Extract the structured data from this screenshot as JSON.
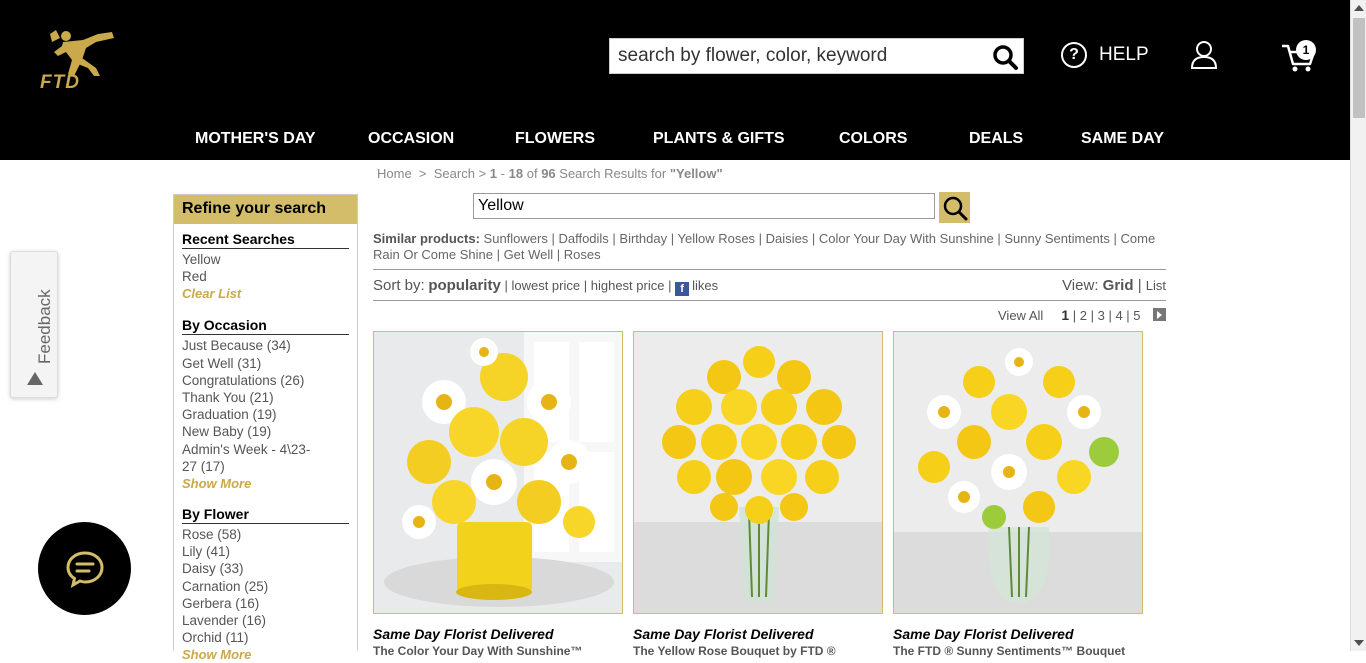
{
  "header": {
    "logo_text": "FTD",
    "search_placeholder": "search by flower, color, keyword",
    "help_label": "HELP",
    "cart_count": "1"
  },
  "nav": [
    "MOTHER'S DAY",
    "OCCASION",
    "FLOWERS",
    "PLANTS & GIFTS",
    "COLORS",
    "DEALS",
    "SAME DAY"
  ],
  "feedback_label": "Feedback",
  "breadcrumb": {
    "home": "Home",
    "sep": ">",
    "search": "Search",
    "range_start": "1",
    "dash": "-",
    "range_end": "18",
    "of": "of",
    "total": "96",
    "results_text": "Search Results for",
    "query_quoted": "\"Yellow\""
  },
  "sidebar": {
    "heading": "Refine your search",
    "recent": {
      "title": "Recent Searches",
      "items": [
        "Yellow",
        "Red"
      ],
      "clear": "Clear List"
    },
    "occasion": {
      "title": "By Occasion",
      "items": [
        "Just Because (34)",
        "Get Well (31)",
        "Congratulations (26)",
        "Thank You (21)",
        "Graduation (19)",
        "New Baby (19)",
        "Admin's Week - 4\\23-",
        "27 (17)"
      ],
      "more": "Show More"
    },
    "flower": {
      "title": "By Flower",
      "items": [
        "Rose (58)",
        "Lily (41)",
        "Daisy (33)",
        "Carnation (25)",
        "Gerbera (16)",
        "Lavender (16)",
        "Orchid (11)"
      ],
      "more": "Show More"
    }
  },
  "search2": {
    "value": "Yellow"
  },
  "similar": {
    "label": "Similar products:",
    "items": [
      "Sunflowers",
      "Daffodils",
      "Birthday",
      "Yellow Roses",
      "Daisies",
      "Color Your Day With Sunshine",
      "Sunny Sentiments",
      "Come Rain Or Come Shine",
      "Get Well",
      "Roses"
    ]
  },
  "sort": {
    "label": "Sort by:",
    "active": "popularity",
    "options": [
      "lowest price",
      "highest price"
    ],
    "likes": "likes",
    "fb_glyph": "f",
    "view_label": "View:",
    "view_active": "Grid",
    "view_other": "List",
    "sep": "|"
  },
  "pager": {
    "view_all": "View All",
    "pages": [
      "1",
      "2",
      "3",
      "4",
      "5"
    ]
  },
  "products": [
    {
      "title": "Same Day Florist Delivered",
      "subtitle": "The Color Your Day With Sunshine™"
    },
    {
      "title": "Same Day Florist Delivered",
      "subtitle": "The Yellow Rose Bouquet by FTD ®"
    },
    {
      "title": "Same Day Florist Delivered",
      "subtitle": "The FTD ® Sunny Sentiments™ Bouquet"
    }
  ],
  "colors": {
    "gold": "#d4bd6a",
    "black": "#000000",
    "facebook": "#3b5998"
  }
}
